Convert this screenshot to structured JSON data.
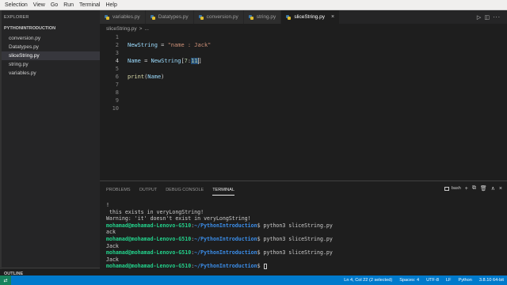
{
  "menubar": {
    "items": [
      "Selection",
      "View",
      "Go",
      "Run",
      "Terminal",
      "Help"
    ]
  },
  "sidebar": {
    "title": "EXPLORER",
    "project": "PYTHONINTRODUCTION",
    "files": [
      "conversion.py",
      "Datatypes.py",
      "sliceString.py",
      "string.py",
      "variables.py"
    ],
    "active_file": "sliceString.py",
    "outline": "OUTLINE"
  },
  "tabs": [
    {
      "label": "variables.py",
      "active": false
    },
    {
      "label": "Datatypes.py",
      "active": false
    },
    {
      "label": "conversion.py",
      "active": false
    },
    {
      "label": "string.py",
      "active": false
    },
    {
      "label": "sliceString.py",
      "active": true
    }
  ],
  "tab_close": "×",
  "tab_actions": "▷ ◫ ···",
  "breadcrumb": {
    "file": "sliceString.py",
    "sep": ">",
    "symbol": "..."
  },
  "editor": {
    "line_numbers": [
      "1",
      "2",
      "3",
      "4",
      "5",
      "6",
      "7",
      "8",
      "9",
      "10"
    ],
    "current_line": 4,
    "line2": {
      "var": "NewString",
      "op": " = ",
      "str": "\"name : Jack\""
    },
    "line4": {
      "var1": "Name",
      "op": " = ",
      "var2": "NewString",
      "bracket_open": "[",
      "num1": "7",
      "colon": ":",
      "num2_selected": "11",
      "bracket_close": "]"
    },
    "line6": {
      "fn": "print",
      "paren_open": "(",
      "var": "Name",
      "paren_close": ")"
    }
  },
  "panel": {
    "tabs": [
      "PROBLEMS",
      "OUTPUT",
      "DEBUG CONSOLE",
      "TERMINAL"
    ],
    "active_tab": "TERMINAL",
    "shell": "bash",
    "actions": [
      "+",
      "⧉",
      "🗑",
      "∧",
      "×"
    ]
  },
  "terminal": {
    "prompt_user": "mohamad@mohamad-Lenovo-G510",
    "prompt_sep": ":",
    "prompt_path": "~/PythonIntroduction",
    "prompt_end": "$ ",
    "lines": [
      {
        "type": "out",
        "text": "!"
      },
      {
        "type": "out",
        "text": " this exists in veryLongString!"
      },
      {
        "type": "out",
        "text": "Warning: 'it' doesn't exist in veryLongString!"
      },
      {
        "type": "cmd",
        "text": "python3 sliceString.py"
      },
      {
        "type": "out",
        "text": "ack"
      },
      {
        "type": "cmd",
        "text": "python3 sliceString.py"
      },
      {
        "type": "out",
        "text": "Jack"
      },
      {
        "type": "cmd",
        "text": "python3 sliceString.py"
      },
      {
        "type": "out",
        "text": "Jack"
      },
      {
        "type": "cmd",
        "text": ""
      }
    ]
  },
  "statusbar": {
    "remote": "⇄",
    "position": "Ln 4, Col 22 (2 selected)",
    "spaces": "Spaces: 4",
    "encoding": "UTF-8",
    "eol": "LF",
    "language": "Python",
    "interpreter": "3.8.10 64-bit"
  }
}
